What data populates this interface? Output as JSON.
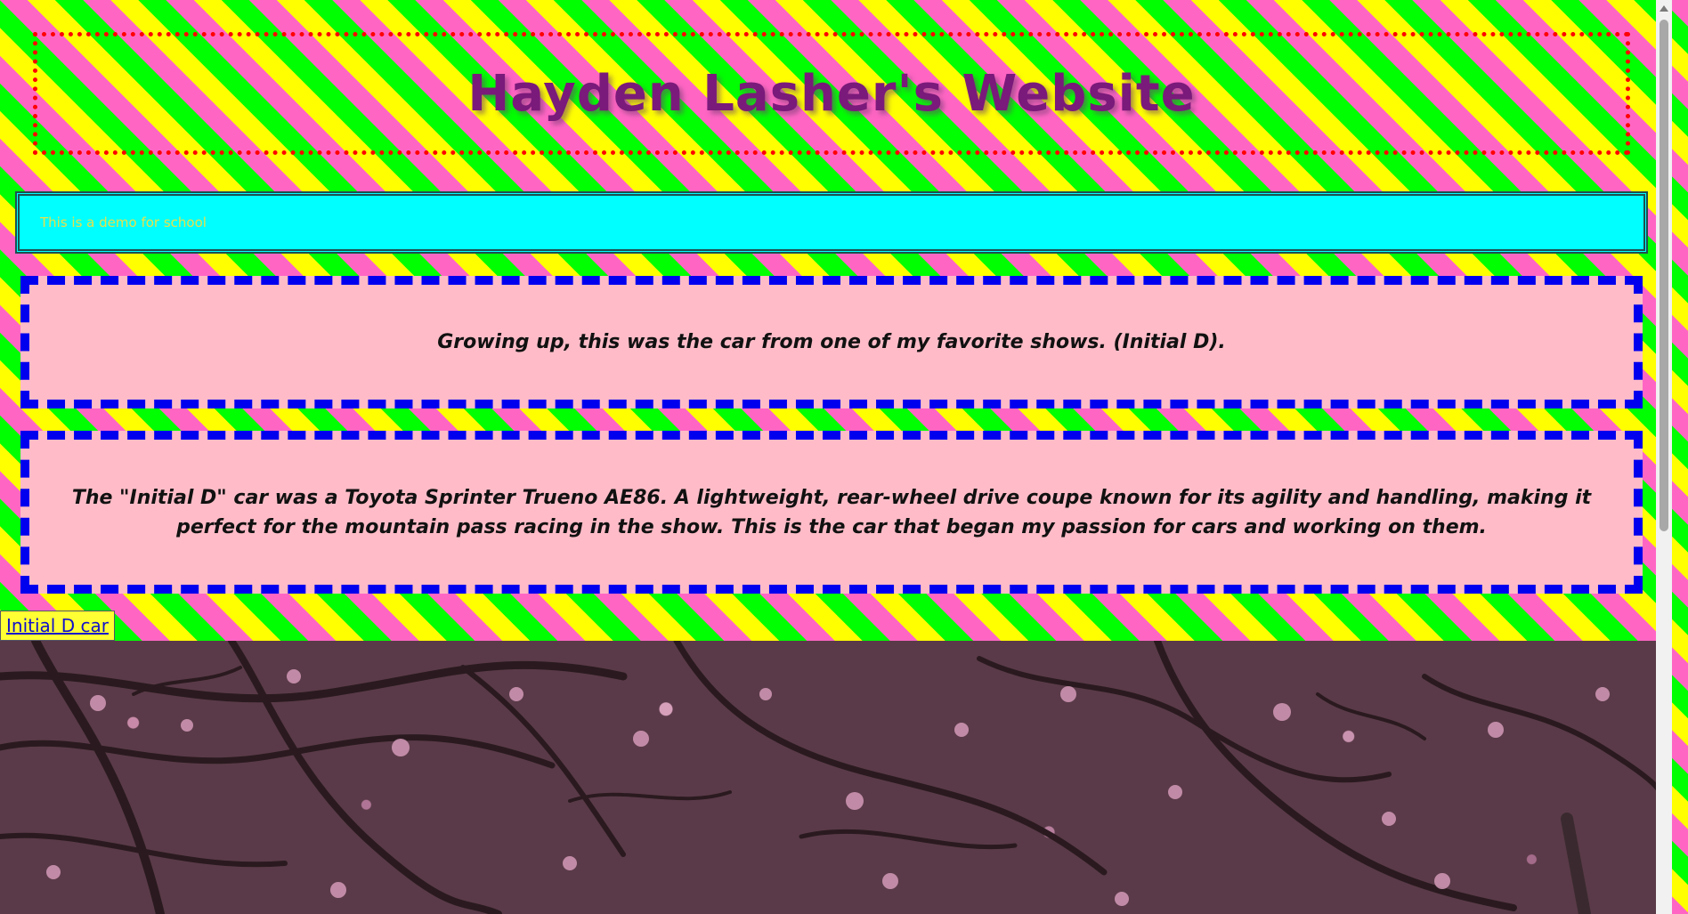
{
  "header": {
    "title": "Hayden Lasher's Website"
  },
  "demo_notice": {
    "text": "This is a demo for school"
  },
  "cards": [
    {
      "text": "Growing up, this was the car from one of my favorite shows. (Initial D)."
    },
    {
      "text": "The \"Initial D\" car was a Toyota Sprinter Trueno AE86. A lightweight, rear-wheel drive coupe known for its agility and handling, making it perfect for the mountain pass racing in the show. This is the car that began my passion for cars and working on them."
    }
  ],
  "link": {
    "label": "Initial D car"
  },
  "photo": {
    "subject": "cherry blossom tree branches"
  },
  "colors": {
    "stripe_pink": "#ff66c4",
    "stripe_yellow": "#ffff00",
    "stripe_green": "#00ff00",
    "title_purple": "#7a1a7a",
    "title_border_red": "#ff0000",
    "demo_bar_cyan": "#00ffff",
    "card_pink": "#ffbcc8",
    "card_border_blue": "#0000ee",
    "link_blue": "#1010cc"
  }
}
